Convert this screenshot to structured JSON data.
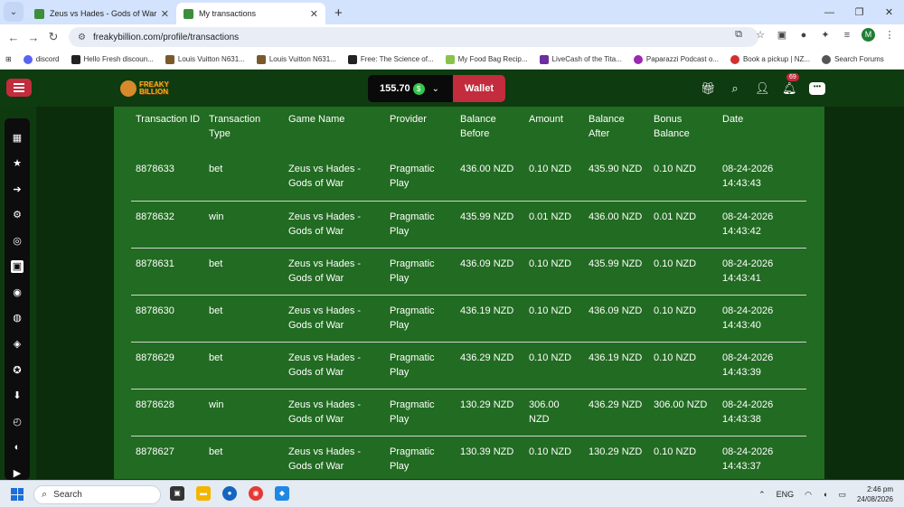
{
  "browser": {
    "tabs": [
      {
        "title": "Zeus vs Hades - Gods of War | F",
        "active": false
      },
      {
        "title": "My transactions",
        "active": true
      }
    ],
    "url": "freakybillion.com/profile/transactions",
    "profile_initial": "M",
    "bookmarks": [
      "discord",
      "Hello Fresh discoun...",
      "Louis Vuitton N631...",
      "Louis Vuitton N631...",
      "Free: The Science of...",
      "My Food Bag Recip...",
      "LiveCash of the Tita...",
      "Paparazzi Podcast o...",
      "Book a pickup | NZ...",
      "Search Forums"
    ]
  },
  "site": {
    "logo_line1": "FREAKY",
    "logo_line2": "BILLION",
    "balance": "155.70",
    "coin_symbol": "$",
    "wallet_label": "Wallet",
    "notification_count": "69",
    "accent_color": "#c22c3c",
    "panel_color": "#226b22"
  },
  "sidebar_icons": [
    "calendar-icon",
    "star-icon",
    "arrow-right-icon",
    "gear-icon",
    "target-icon",
    "wallet-icon",
    "user-icon",
    "chip-icon",
    "shield-icon",
    "badge-icon",
    "download-icon",
    "timer-icon",
    "coin-icon",
    "play-icon"
  ],
  "transactions": {
    "headers": [
      "Transaction ID",
      "Transaction Type",
      "Game Name",
      "Provider",
      "Balance Before",
      "Amount",
      "Balance After",
      "Bonus Balance",
      "Date"
    ],
    "rows": [
      [
        "8878633",
        "bet",
        "Zeus vs Hades - Gods of War",
        "Pragmatic Play",
        "436.00 NZD",
        "0.10 NZD",
        "435.90 NZD",
        "0.10 NZD",
        "08-24-2026 14:43:43"
      ],
      [
        "8878632",
        "win",
        "Zeus vs Hades - Gods of War",
        "Pragmatic Play",
        "435.99 NZD",
        "0.01 NZD",
        "436.00 NZD",
        "0.01 NZD",
        "08-24-2026 14:43:42"
      ],
      [
        "8878631",
        "bet",
        "Zeus vs Hades - Gods of War",
        "Pragmatic Play",
        "436.09 NZD",
        "0.10 NZD",
        "435.99 NZD",
        "0.10 NZD",
        "08-24-2026 14:43:41"
      ],
      [
        "8878630",
        "bet",
        "Zeus vs Hades - Gods of War",
        "Pragmatic Play",
        "436.19 NZD",
        "0.10 NZD",
        "436.09 NZD",
        "0.10 NZD",
        "08-24-2026 14:43:40"
      ],
      [
        "8878629",
        "bet",
        "Zeus vs Hades - Gods of War",
        "Pragmatic Play",
        "436.29 NZD",
        "0.10 NZD",
        "436.19 NZD",
        "0.10 NZD",
        "08-24-2026 14:43:39"
      ],
      [
        "8878628",
        "win",
        "Zeus vs Hades - Gods of War",
        "Pragmatic Play",
        "130.29 NZD",
        "306.00 NZD",
        "436.29 NZD",
        "306.00 NZD",
        "08-24-2026 14:43:38"
      ],
      [
        "8878627",
        "bet",
        "Zeus vs Hades - Gods of War",
        "Pragmatic Play",
        "130.39 NZD",
        "0.10 NZD",
        "130.29 NZD",
        "0.10 NZD",
        "08-24-2026 14:43:37"
      ]
    ]
  },
  "taskbar": {
    "search_placeholder": "Search",
    "language": "ENG",
    "time": "2:46 pm",
    "date": "24/08/2026"
  }
}
